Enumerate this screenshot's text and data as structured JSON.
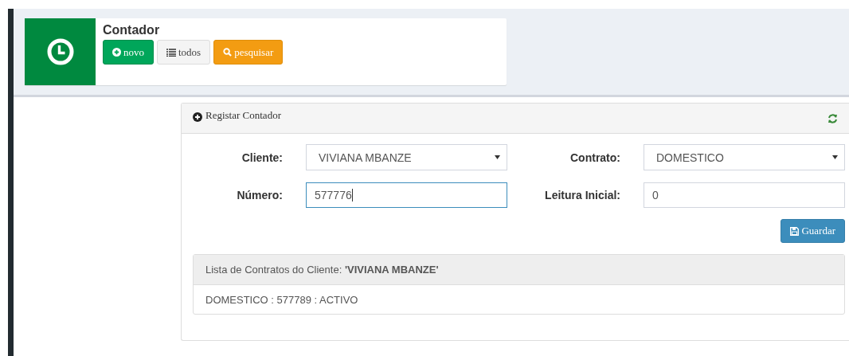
{
  "header": {
    "title": "Contador",
    "buttons": [
      {
        "label": "novo",
        "kind": "new"
      },
      {
        "label": "todos",
        "kind": "list"
      },
      {
        "label": "pesquisar",
        "kind": "search"
      }
    ]
  },
  "panel": {
    "title": "Registar Contador",
    "fields": [
      {
        "label": "Cliente:",
        "kind": "select",
        "value": "VIVIANA MBANZE",
        "focused": false
      },
      {
        "label": "Contrato:",
        "kind": "select",
        "value": "DOMESTICO",
        "focused": false
      },
      {
        "label": "Número:",
        "kind": "text",
        "value": "577776",
        "focused": true
      },
      {
        "label": "Leitura Inicial:",
        "kind": "text",
        "value": "0",
        "focused": false
      }
    ],
    "save_button": "Guardar",
    "contracts": {
      "heading": "Lista de Contratos do Cliente: **'VIVIANA MBANZE'**",
      "items": [
        "DOMESTICO : 577789 : ACTIVO"
      ]
    }
  }
}
